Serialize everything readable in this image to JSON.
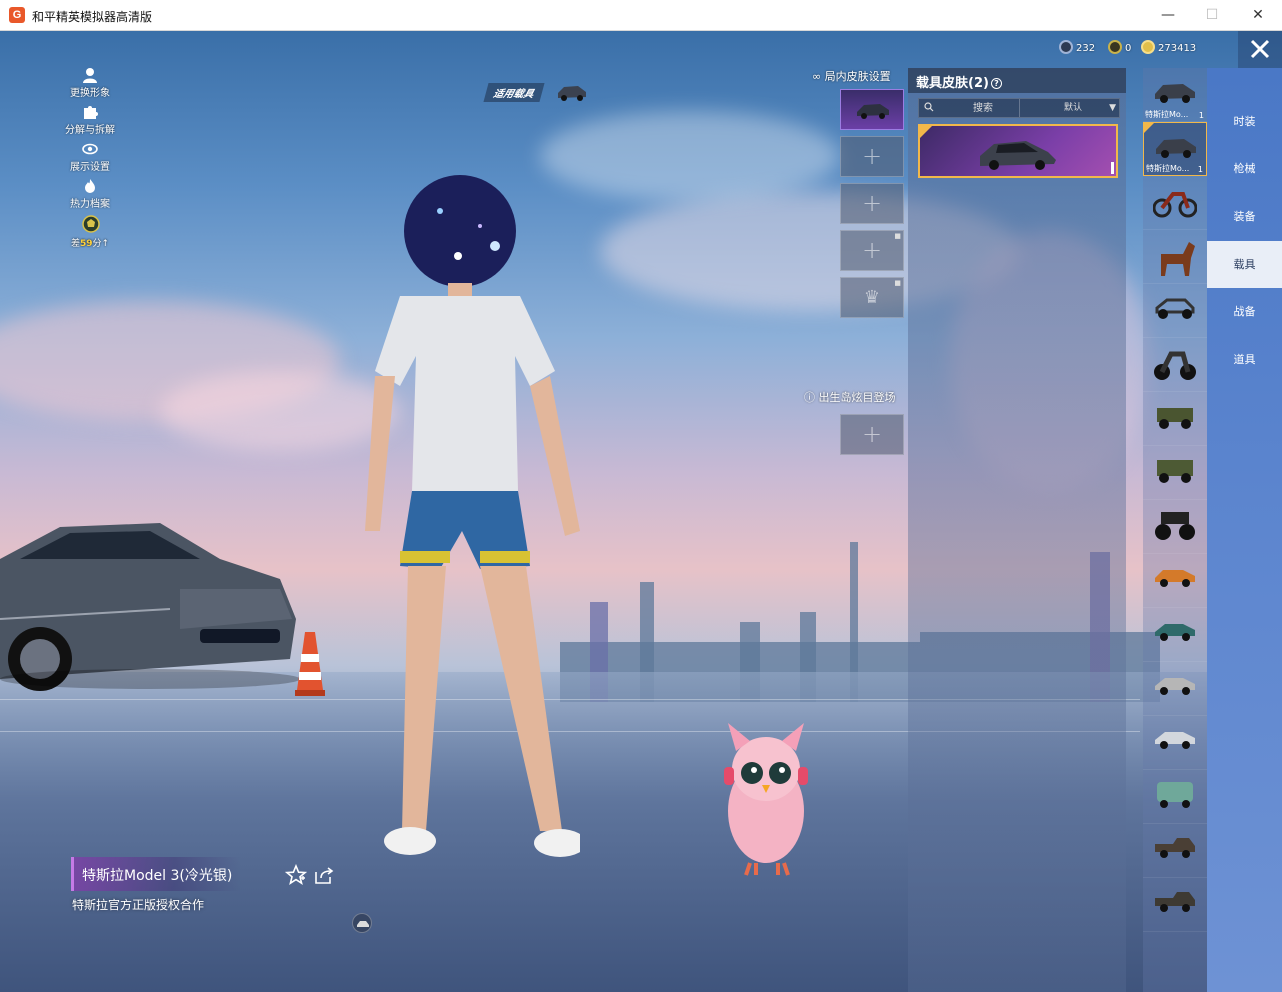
{
  "window": {
    "title": "和平精英模拟器高清版",
    "minimize": "—",
    "maximize": "☐",
    "close": "✕"
  },
  "currency": {
    "coupons": "232",
    "tokens": "0",
    "gold": "273413"
  },
  "left_menu": {
    "items": [
      {
        "label": "更换形象",
        "icon": "person-icon"
      },
      {
        "label": "分解与拆解",
        "icon": "puzzle-icon"
      },
      {
        "label": "展示设置",
        "icon": "eye-icon"
      },
      {
        "label": "热力档案",
        "icon": "flame-icon"
      }
    ],
    "badge": {
      "prefix": "差",
      "value": "59",
      "suffix": "分"
    }
  },
  "applied_vehicle": {
    "label": "适用载具"
  },
  "slots": {
    "in_game_header": "局内皮肤设置",
    "spawn_header": "出生岛炫目登场",
    "plus": "+"
  },
  "skin_panel": {
    "title": "载具皮肤",
    "count": "(2)",
    "help": "?",
    "search_placeholder": "搜索",
    "sort_label": "默认"
  },
  "vehicles": {
    "selected_label": "特斯拉Mo...",
    "first_label": "特斯拉Mo...",
    "first_count": "1",
    "selected_count": "1"
  },
  "categories": [
    {
      "label": "时装",
      "active": false
    },
    {
      "label": "枪械",
      "active": false
    },
    {
      "label": "装备",
      "active": false
    },
    {
      "label": "载具",
      "active": true
    },
    {
      "label": "战备",
      "active": false
    },
    {
      "label": "道具",
      "active": false
    }
  ],
  "selected_skin": {
    "name": "特斯拉Model 3(冷光银)",
    "description": "特斯拉官方正版授权合作"
  },
  "colors": {
    "accent_gold": "#f2b84a",
    "purple_card": "#7b3fa8",
    "tab_blue": "#4a78c6",
    "active_tab_bg": "#e9eef7"
  }
}
